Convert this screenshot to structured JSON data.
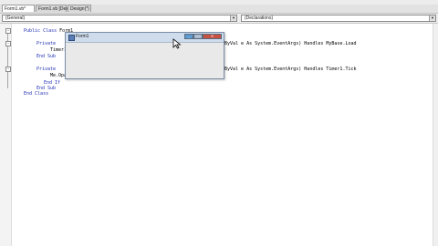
{
  "tabs": [
    {
      "label": "Form1.vb*",
      "active": true
    },
    {
      "label": "Form1.vb [Design]*",
      "active": false
    },
    {
      "label": "Design(*)",
      "active": false
    }
  ],
  "dropdowns": {
    "left": "(General)",
    "right": "(Declarations)"
  },
  "code": {
    "line1_kw": "Public Class",
    "line1_name": " Form1",
    "line2_kw": "Private",
    "line2_tail": "ByVal e As System.EventArgs) Handles MyBase.Load",
    "line3": "Timer1",
    "line4": "End Sub",
    "line5_kw": "Private",
    "line5_tail": "ByVal e As System.EventArgs) Handles Timer1.Tick",
    "line6": "Me.Opacity",
    "line7": "End If",
    "line8": "End Sub",
    "line9": "End Class"
  },
  "form_window": {
    "title": "Form1"
  },
  "colors": {
    "keyword": "#1f2fb5",
    "title_bar": "#cfdcec",
    "close_button": "#c8503e"
  }
}
